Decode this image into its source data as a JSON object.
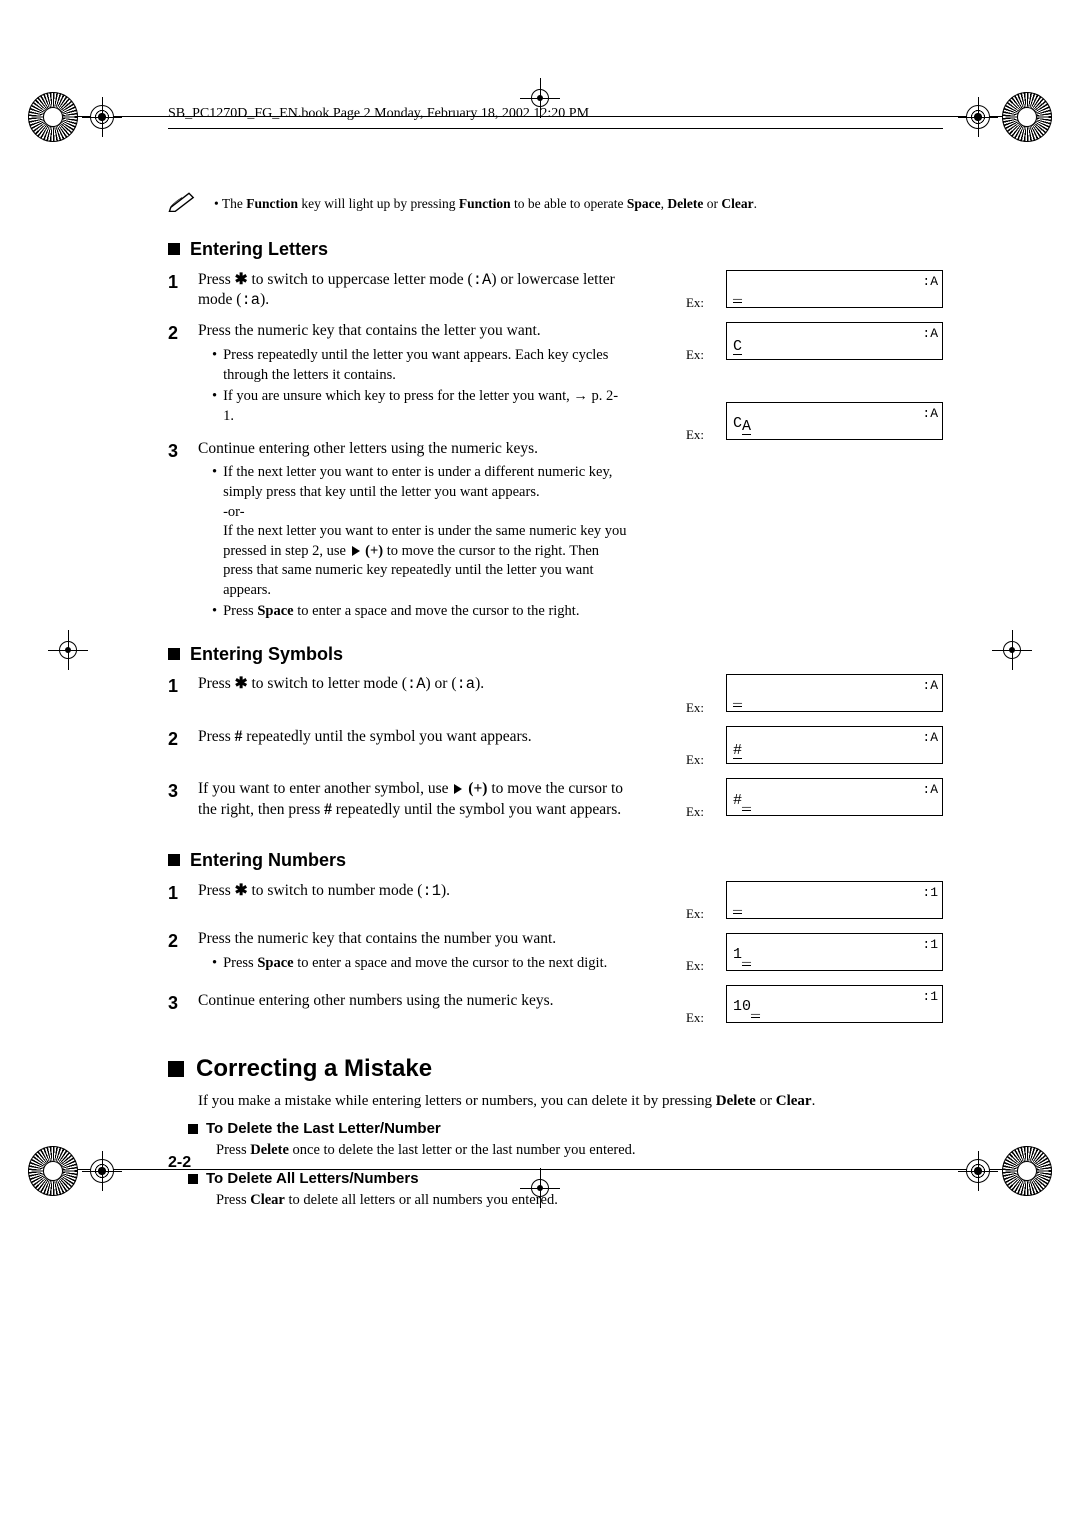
{
  "running_head": "SB_PC1270D_FG_EN.book  Page 2  Monday, February 18, 2002  12:20 PM",
  "page_number": "2-2",
  "note_bullet": "•",
  "note_prefix": "The ",
  "note_bold1": "Function",
  "note_mid1": " key will light up by pressing ",
  "note_bold2": "Function",
  "note_mid2": " to be able to operate ",
  "note_bold3": "Space",
  "note_mid3": ", ",
  "note_bold4": "Delete",
  "note_mid4": " or ",
  "note_bold5": "Clear",
  "note_end": ".",
  "sect_letters": "Entering Letters",
  "letters_step1_a": "Press ",
  "letters_step1_b": " to switch to uppercase letter mode (",
  "letters_step1_mode_u": ":A",
  "letters_step1_c": ") or lowercase letter mode (",
  "letters_step1_mode_l": ":a",
  "letters_step1_d": ").",
  "star_glyph": "✱",
  "letters_step2_main": "Press the numeric key that contains the letter you want.",
  "letters_step2_b1": "Press repeatedly until the letter you want appears. Each key cycles through the letters it contains.",
  "letters_step2_b2_a": "If you are unsure which key to press for the letter you want, ",
  "letters_step2_b2_arrow": "→",
  "letters_step2_b2_b": " p. 2-1.",
  "letters_step3_main": "Continue entering other letters using the numeric keys.",
  "letters_step3_b1": "If the next letter you want to enter is under a different numeric key, simply press that key until the letter you want appears.",
  "letters_step3_or": "-or-",
  "letters_step3_b2a": "If the next letter you want to enter is under the same numeric key you pressed in step 2, use ",
  "letters_step3_b2plus": "(+)",
  "letters_step3_b2b": " to move the cursor to the right. Then press that same numeric key repeatedly until the letter you want appears.",
  "letters_step3_b3a": "Press ",
  "letters_step3_b3bold": "Space",
  "letters_step3_b3b": " to enter a space and move the cursor to the right.",
  "sect_symbols": "Entering Symbols",
  "sym_step1_a": "Press ",
  "sym_step1_b": " to switch to letter mode (",
  "sym_step1_c": ") or (",
  "sym_step1_d": ").",
  "sym_step2_a": "Press ",
  "sym_step2_hash": "#",
  "sym_step2_b": " repeatedly until the symbol you want appears.",
  "sym_step3_a": "If you want to enter another symbol, use ",
  "sym_step3_plus": "(+)",
  "sym_step3_b": " to move the cursor to the right, then press ",
  "sym_step3_c": " repeatedly until the symbol you want appears.",
  "sect_numbers": "Entering Numbers",
  "num_step1_a": "Press ",
  "num_step1_b": " to switch to number mode (",
  "num_step1_mode": ":1",
  "num_step1_c": ").",
  "num_step2_main": "Press the numeric key that contains the number you want.",
  "num_step2_b1a": "Press ",
  "num_step2_b1bold": "Space",
  "num_step2_b1b": " to enter a space and move the cursor to the next digit.",
  "num_step3_main": "Continue entering other numbers using the numeric keys.",
  "sect_correct": "Correcting a Mistake",
  "correct_intro_a": "If you make a mistake while entering letters or numbers, you can delete it by pressing ",
  "correct_intro_b1": "Delete",
  "correct_intro_mid": " or ",
  "correct_intro_b2": "Clear",
  "correct_intro_end": ".",
  "sub_delete_last": "To Delete the Last Letter/Number",
  "del_last_a": "Press ",
  "del_last_bold": "Delete",
  "del_last_b": " once to delete the last letter or the last number you entered.",
  "sub_delete_all": "To Delete All Letters/Numbers",
  "del_all_a": "Press ",
  "del_all_bold": "Clear",
  "del_all_b": " to delete all letters or all numbers you entered.",
  "ex_label": "Ex:",
  "cursor": "_",
  "modeA": ":A",
  "mode1": ":1",
  "lcd_letters_1": "",
  "lcd_letters_2": "C",
  "lcd_letters_3a": "C",
  "lcd_letters_3b": "A",
  "lcd_sym_2": "#",
  "lcd_sym_3": "#",
  "lcd_num_2": "1",
  "lcd_num_3": "10"
}
